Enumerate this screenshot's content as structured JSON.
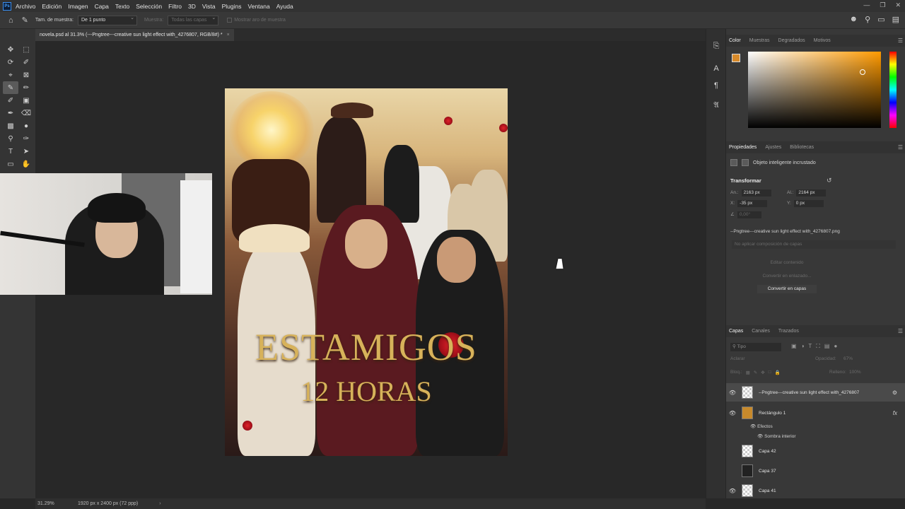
{
  "menubar": {
    "items": [
      "Archivo",
      "Edición",
      "Imagen",
      "Capa",
      "Texto",
      "Selección",
      "Filtro",
      "3D",
      "Vista",
      "Plugins",
      "Ventana",
      "Ayuda"
    ]
  },
  "options": {
    "sample_size_label": "Tam. de muestra:",
    "sample_size_value": "De 1 punto",
    "sample_label": "Muestra:",
    "sample_value": "Todas las capas",
    "ring_label": "Mostrar aro de muestra"
  },
  "document": {
    "tab_title": "novela.psd al 31.3% (---Pngtree---creative sun light effect with_4276807, RGB/8#) *",
    "zoom": "31.29%",
    "dimensions": "1920 px x 2400 px (72 ppp)"
  },
  "artwork": {
    "title_line1": "ESTAMIGOS",
    "title_line2": "12 HORAS",
    "title_color": "#d7b25a"
  },
  "color_panel": {
    "tabs": [
      "Color",
      "Muestras",
      "Degradados",
      "Motivos"
    ],
    "foreground": "#d88a2a",
    "background": "#ffffff"
  },
  "properties_panel": {
    "tabs": [
      "Propiedades",
      "Ajustes",
      "Bibliotecas"
    ],
    "object_type": "Objeto inteligente incrustado",
    "transform_title": "Transformar",
    "width_label": "An.:",
    "width_value": "2163 px",
    "height_label": "Al.:",
    "height_value": "2164 px",
    "x_label": "X:",
    "x_value": "-35 px",
    "y_label": "Y:",
    "y_value": "0 px",
    "angle_value": "0,00°",
    "file_name": "--Pngtree---creative sun light effect with_4276807.png",
    "layer_comp": "No aplicar composición de capas",
    "btn_edit": "Editar contenido",
    "btn_linked": "Convertir en enlazado...",
    "btn_layers": "Convertir en capas"
  },
  "layers_panel": {
    "tabs": [
      "Capas",
      "Canales",
      "Trazados"
    ],
    "search_placeholder": "Tipo",
    "blend_mode": "Aclarar",
    "opacity_label": "Opacidad:",
    "opacity_value": "67%",
    "lock_label": "Bloq.:",
    "fill_label": "Relleno:",
    "fill_value": "100%",
    "layers": [
      {
        "name": "--Pngtree---creative sun light effect with_4276807",
        "visible": true,
        "selected": true
      },
      {
        "name": "Rectángulo 1",
        "visible": true,
        "selected": false
      },
      {
        "name": "Capa 42",
        "visible": false,
        "selected": false
      },
      {
        "name": "Capa 37",
        "visible": false,
        "selected": false
      },
      {
        "name": "Capa 41",
        "visible": true,
        "selected": false
      }
    ],
    "effects_label": "Efectos",
    "effect_inner_shadow": "Sombra interior"
  }
}
